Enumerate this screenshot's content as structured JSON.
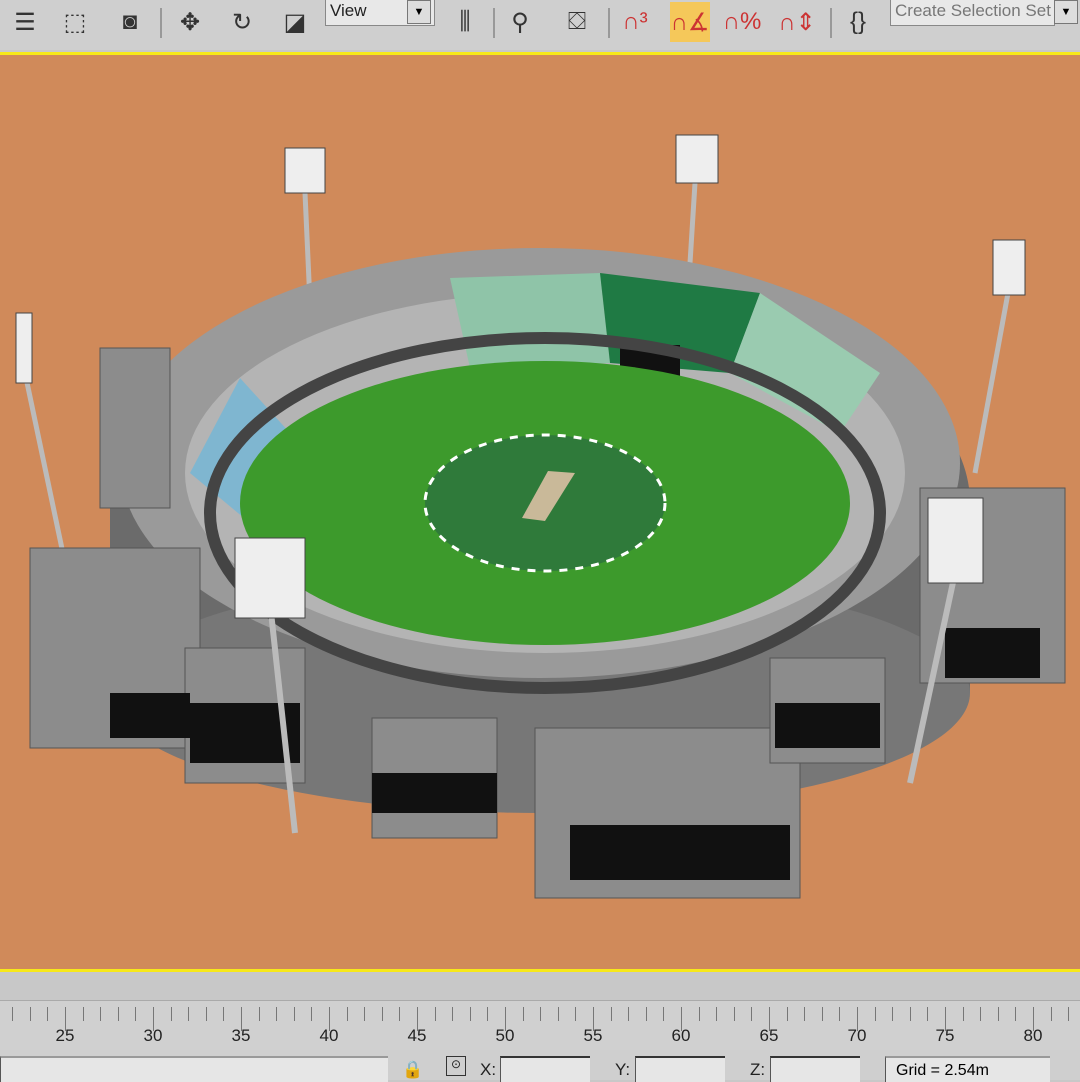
{
  "toolbar": {
    "tools": [
      {
        "name": "select-by-name-icon",
        "glyph": "☰"
      },
      {
        "name": "rect-selection-region-icon",
        "glyph": "⬚"
      },
      {
        "name": "window-crossing-icon",
        "glyph": "◙"
      },
      {
        "name": "move-icon",
        "glyph": "✥"
      },
      {
        "name": "rotate-icon",
        "glyph": "↻"
      },
      {
        "name": "scale-icon",
        "glyph": "◪"
      }
    ],
    "reference_coord": "View",
    "tools2": [
      {
        "name": "pivot-center-icon",
        "glyph": "⫼"
      },
      {
        "name": "select-manipulate-icon",
        "glyph": "⚲"
      },
      {
        "name": "keyboard-shortcut-override-icon",
        "glyph": "⛋"
      },
      {
        "name": "snap-3d-icon",
        "glyph": "∩³"
      },
      {
        "name": "angle-snap-icon",
        "glyph": "∩∡",
        "active": true
      },
      {
        "name": "percent-snap-icon",
        "glyph": "∩%"
      },
      {
        "name": "spinner-snap-icon",
        "glyph": "∩⇕"
      },
      {
        "name": "edit-named-selection-icon",
        "glyph": "{}"
      }
    ],
    "named_selection_placeholder": "Create Selection Set"
  },
  "colors": {
    "viewport_bg": "#d08a5a",
    "active_border": "#f7e81a",
    "accent_active": "#f5c85a"
  },
  "timeline": {
    "labels": [
      "25",
      "30",
      "35",
      "40",
      "45",
      "50",
      "55",
      "60",
      "65",
      "70",
      "75",
      "80"
    ]
  },
  "status": {
    "x_label": "X:",
    "y_label": "Y:",
    "z_label": "Z:",
    "x": "",
    "y": "",
    "z": "",
    "grid": "Grid = 2.54m"
  }
}
